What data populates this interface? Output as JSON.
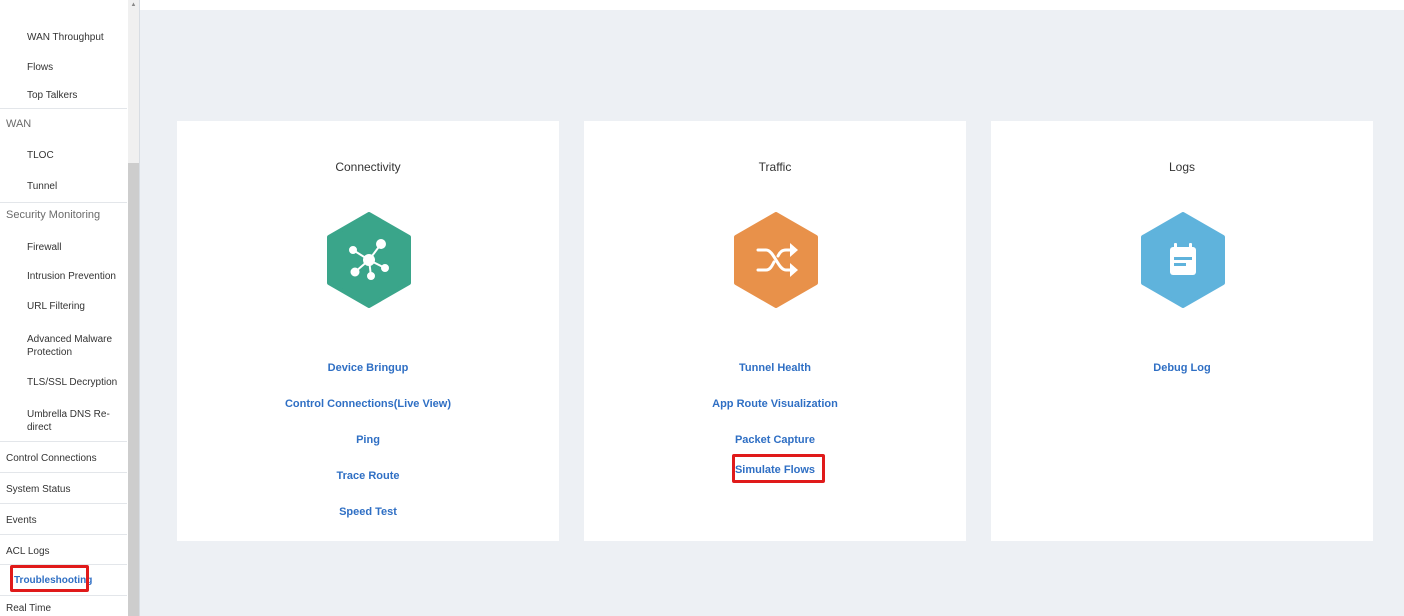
{
  "sidebar": {
    "items": [
      {
        "label": "WAN Throughput",
        "kind": "sub"
      },
      {
        "label": "Flows",
        "kind": "sub"
      },
      {
        "label": "Top Talkers",
        "kind": "sub"
      },
      {
        "label": "WAN",
        "kind": "section"
      },
      {
        "label": "TLOC",
        "kind": "sub"
      },
      {
        "label": "Tunnel",
        "kind": "sub"
      },
      {
        "label": "Security Monitoring",
        "kind": "section"
      },
      {
        "label": "Firewall",
        "kind": "sub"
      },
      {
        "label": "Intrusion Prevention",
        "kind": "sub"
      },
      {
        "label": "URL Filtering",
        "kind": "sub"
      },
      {
        "label": "Advanced Malware Protection",
        "kind": "sub"
      },
      {
        "label": "TLS/SSL Decryption",
        "kind": "sub"
      },
      {
        "label": "Umbrella DNS Re-direct",
        "kind": "sub"
      },
      {
        "label": "Control Connections",
        "kind": "top"
      },
      {
        "label": "System Status",
        "kind": "top"
      },
      {
        "label": "Events",
        "kind": "top"
      },
      {
        "label": "ACL Logs",
        "kind": "top"
      },
      {
        "label": "Troubleshooting",
        "kind": "top",
        "active": true
      },
      {
        "label": "Real Time",
        "kind": "top"
      }
    ]
  },
  "cards": [
    {
      "title": "Connectivity",
      "icon": "network-hub-icon",
      "color": "#3aa58a",
      "links": [
        "Device Bringup",
        "Control Connections(Live View)",
        "Ping",
        "Trace Route",
        "Speed Test"
      ]
    },
    {
      "title": "Traffic",
      "icon": "shuffle-icon",
      "color": "#e8914a",
      "links": [
        "Tunnel Health",
        "App Route Visualization",
        "Packet Capture",
        "Simulate Flows"
      ],
      "highlighted": "Simulate Flows"
    },
    {
      "title": "Logs",
      "icon": "calendar-log-icon",
      "color": "#5fb3dc",
      "links": [
        "Debug Log"
      ]
    }
  ],
  "colors": {
    "accent_link": "#2f6fc4",
    "highlight": "#e01a1a",
    "background": "#edf0f4"
  }
}
